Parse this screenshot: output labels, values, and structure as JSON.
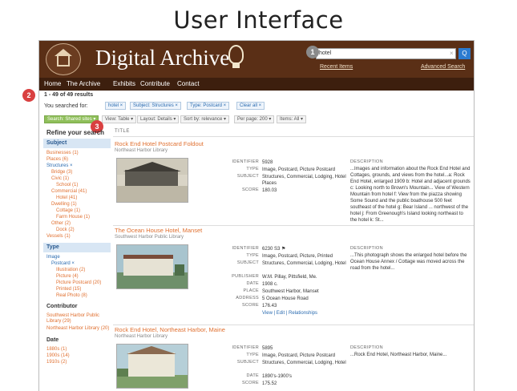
{
  "slide": {
    "title": "User Interface"
  },
  "header": {
    "brand": "Digital Archive",
    "search_value": "hotel",
    "recent_label": "Recent Items",
    "advanced_label": "Advanced Search",
    "clear_glyph": "×",
    "search_glyph": "Q"
  },
  "markers": [
    "1",
    "2",
    "3"
  ],
  "nav": [
    "Home",
    "The Archive",
    "Exhibits",
    "Contribute",
    "Contact"
  ],
  "results": {
    "count": "1 - 49 of 49 results",
    "searched_for": "You searched for:",
    "chips": [
      "hotel ×",
      "Subject: Structures ×",
      "Type: Postcard ×",
      "Clear all ×"
    ],
    "options": [
      "Search: Shared sites ▾",
      "View: Table ▾",
      "Layout: Details ▾",
      "Sort by: relevance ▾",
      "Per page: 200 ▾",
      "Items: All ▾"
    ],
    "column_title": "TITLE"
  },
  "sidebar": {
    "refine": "Refine your search",
    "subject_header": "Subject",
    "subject_items": [
      {
        "text": "Businesses (1)",
        "indent": 0
      },
      {
        "text": "Places (6)",
        "indent": 0
      },
      {
        "text": "Structures ×",
        "indent": 0,
        "selected": true
      },
      {
        "text": "Bridge (3)",
        "indent": 1
      },
      {
        "text": "Civic (1)",
        "indent": 1
      },
      {
        "text": "School (1)",
        "indent": 2
      },
      {
        "text": "Commercial (41)",
        "indent": 1
      },
      {
        "text": "Hotel (41)",
        "indent": 2
      },
      {
        "text": "Dwelling (1)",
        "indent": 1
      },
      {
        "text": "Cottage (1)",
        "indent": 2
      },
      {
        "text": "Farm House (1)",
        "indent": 2
      },
      {
        "text": "Other (2)",
        "indent": 1
      },
      {
        "text": "Dock (2)",
        "indent": 2
      },
      {
        "text": "Vessels (1)",
        "indent": 0
      }
    ],
    "type_header": "Type",
    "type_items": [
      {
        "text": "Image",
        "indent": 0,
        "selected": true
      },
      {
        "text": "Postcard ×",
        "indent": 1,
        "selected": true
      },
      {
        "text": "Illustration (2)",
        "indent": 2
      },
      {
        "text": "Picture (4)",
        "indent": 2
      },
      {
        "text": "Picture Postcard (20)",
        "indent": 2
      },
      {
        "text": "Printed (15)",
        "indent": 2
      },
      {
        "text": "Real Photo (8)",
        "indent": 2
      }
    ],
    "contributor_header": "Contributor",
    "contributor_items": [
      "Southwest Harbor Public Library (29)",
      "Northeast Harbor Library (20)"
    ],
    "date_header": "Date",
    "date_items": [
      "1880s (1)",
      "1900s (14)",
      "1910s (2)"
    ]
  },
  "records": [
    {
      "title": "Rock End Hotel Postcard Foldout",
      "source": "Northeast Harbor Library",
      "fields": [
        {
          "label": "Identifier",
          "value": "5928"
        },
        {
          "label": "Type",
          "value": "Image, Postcard, Picture Postcard"
        },
        {
          "label": "Subject",
          "value": "Structures, Commercial, Lodging, Hotel Places"
        },
        {
          "label": "Score",
          "value": "180.03"
        }
      ],
      "desc_label": "Description",
      "description": "...Images and information about the Rock End Hotel and Cottages, grounds, and views from the hotel...a: Rock End Hotel, enlarged 1909 b: Hotel and adjacent grounds c: Looking north to Brown's Mountain... View of Western Mountain from hotel f: View from the piazza showing Some Sound and the public boathouse 500 feet southeast of the hotel g: Bear Island ... northwest of the hotel j: From Greenough's Island looking northeast to the hotel k: St..."
    },
    {
      "title": "The Ocean House Hotel, Manset",
      "source": "Southwest Harbor Public Library",
      "fields": [
        {
          "label": "Identifier",
          "value": "6230 S3 ⚑"
        },
        {
          "label": "Type",
          "value": "Image, Postcard, Picture, Printed"
        },
        {
          "label": "Subject",
          "value": "Structures, Commercial, Lodging, Hotel"
        },
        {
          "label": "Publisher",
          "value": "W.M. Pillay, Pittsfield, Me."
        },
        {
          "label": "Date",
          "value": "1908 c."
        },
        {
          "label": "Place",
          "value": "Southwest Harbor, Manset"
        },
        {
          "label": "Address",
          "value": "5 Ocean House Road"
        },
        {
          "label": "Score",
          "value": "176.43"
        }
      ],
      "links": "View | Edit | Relationships",
      "desc_label": "Description",
      "description": "...This photograph shows the enlarged hotel before the Ocean House Annex / Cottage was moved across the road from the hotel..."
    },
    {
      "title": "Rock End Hotel, Northeast Harbor, Maine",
      "source": "Northeast Harbor Library",
      "fields": [
        {
          "label": "Identifier",
          "value": "5895"
        },
        {
          "label": "Type",
          "value": "Image, Postcard, Picture Postcard"
        },
        {
          "label": "Subject",
          "value": "Structures, Commercial, Lodging, Hotel"
        },
        {
          "label": "Date",
          "value": "1890's-1900's"
        },
        {
          "label": "Score",
          "value": "175.52"
        }
      ],
      "desc_label": "Description",
      "description": "...Rock End Hotel, Northeast Harbor, Maine..."
    }
  ],
  "colors": {
    "header_bg": "#5a2f16",
    "nav_bg": "#3d1f0e",
    "link_orange": "#e07030",
    "link_blue": "#2a6bb0",
    "marker_red": "#d94040",
    "marker_grey": "#8a8a8a"
  }
}
